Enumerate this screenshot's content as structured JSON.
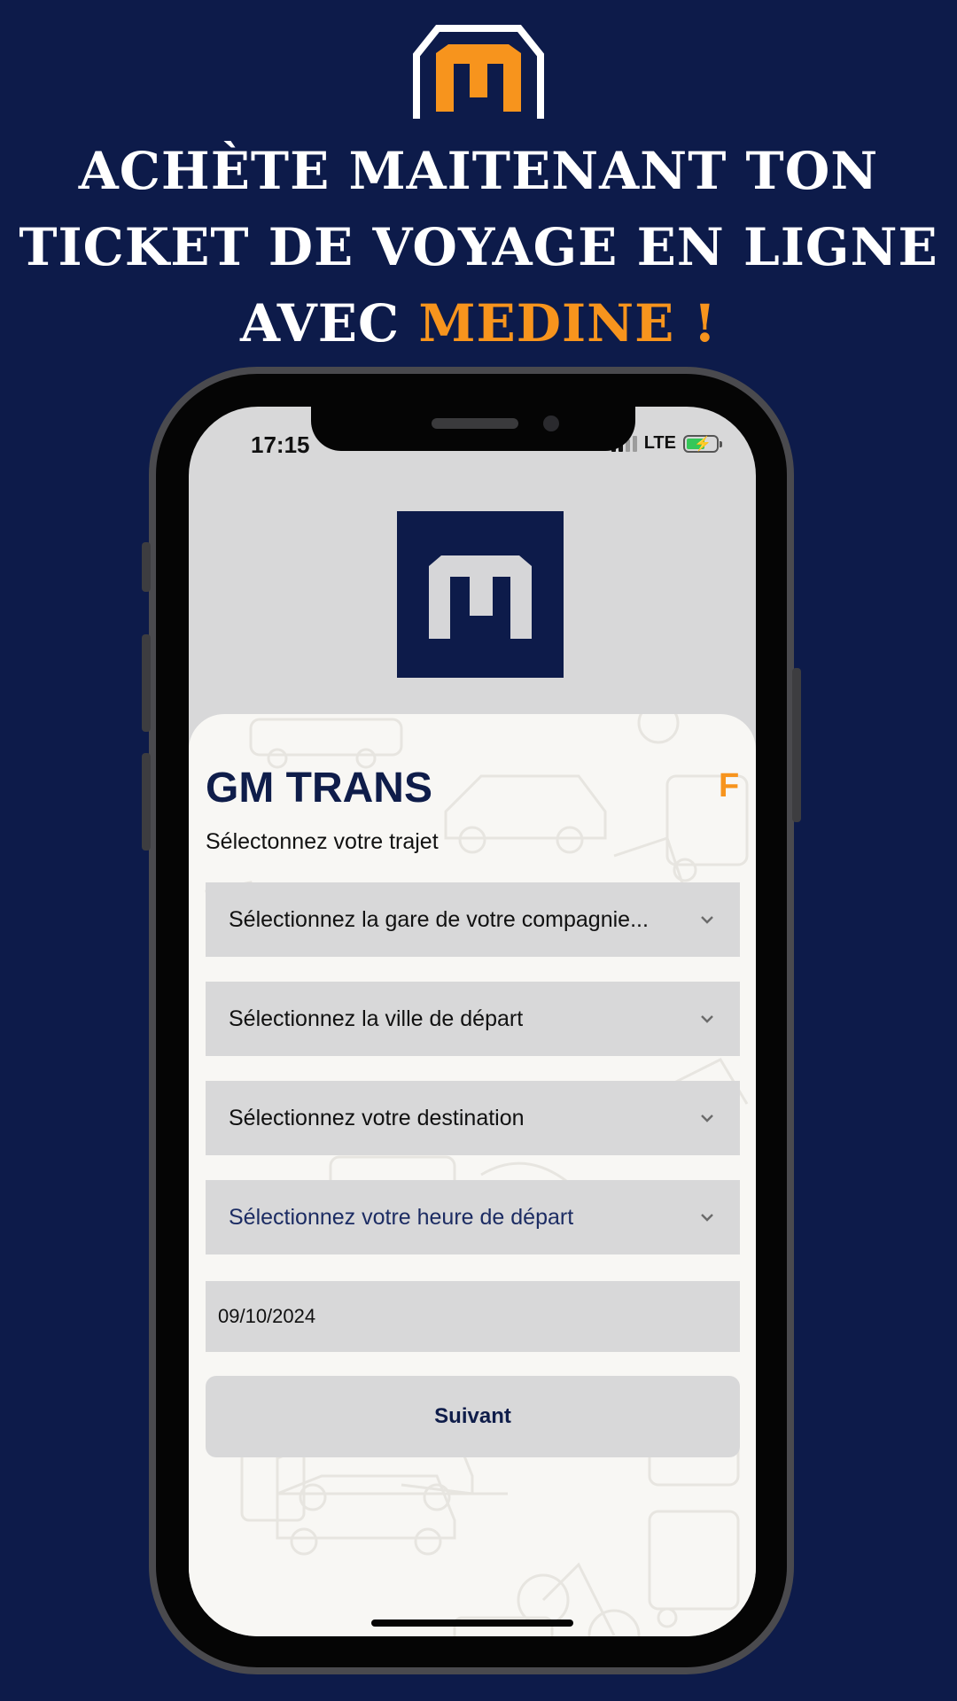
{
  "headline": {
    "line1": "ACHÈTE MAITENANT TON",
    "line2": "TICKET DE VOYAGE EN LIGNE",
    "line3_prefix": "AVEC ",
    "line3_highlight": "MEDINE !"
  },
  "status_bar": {
    "time": "17:15",
    "network": "LTE"
  },
  "app": {
    "company_name": "GM TRANS",
    "company_badge": "F",
    "subtitle": "Sélectonnez votre trajet",
    "dropdowns": [
      {
        "label": "Sélectionnez la gare de votre compagnie..."
      },
      {
        "label": "Sélectionnez la ville de départ"
      },
      {
        "label": "Sélectionnez votre destination"
      },
      {
        "label": "Sélectionnez votre heure de départ"
      }
    ],
    "date_value": "09/10/2024",
    "next_label": "Suivant"
  },
  "colors": {
    "background": "#0d1b4a",
    "accent": "#f7941d",
    "text_dark": "#0f1d4a",
    "field": "#d8d8d9"
  },
  "icons": [
    "medine-logo",
    "signal-icon",
    "battery-charging-icon",
    "chevron-down-icon"
  ]
}
